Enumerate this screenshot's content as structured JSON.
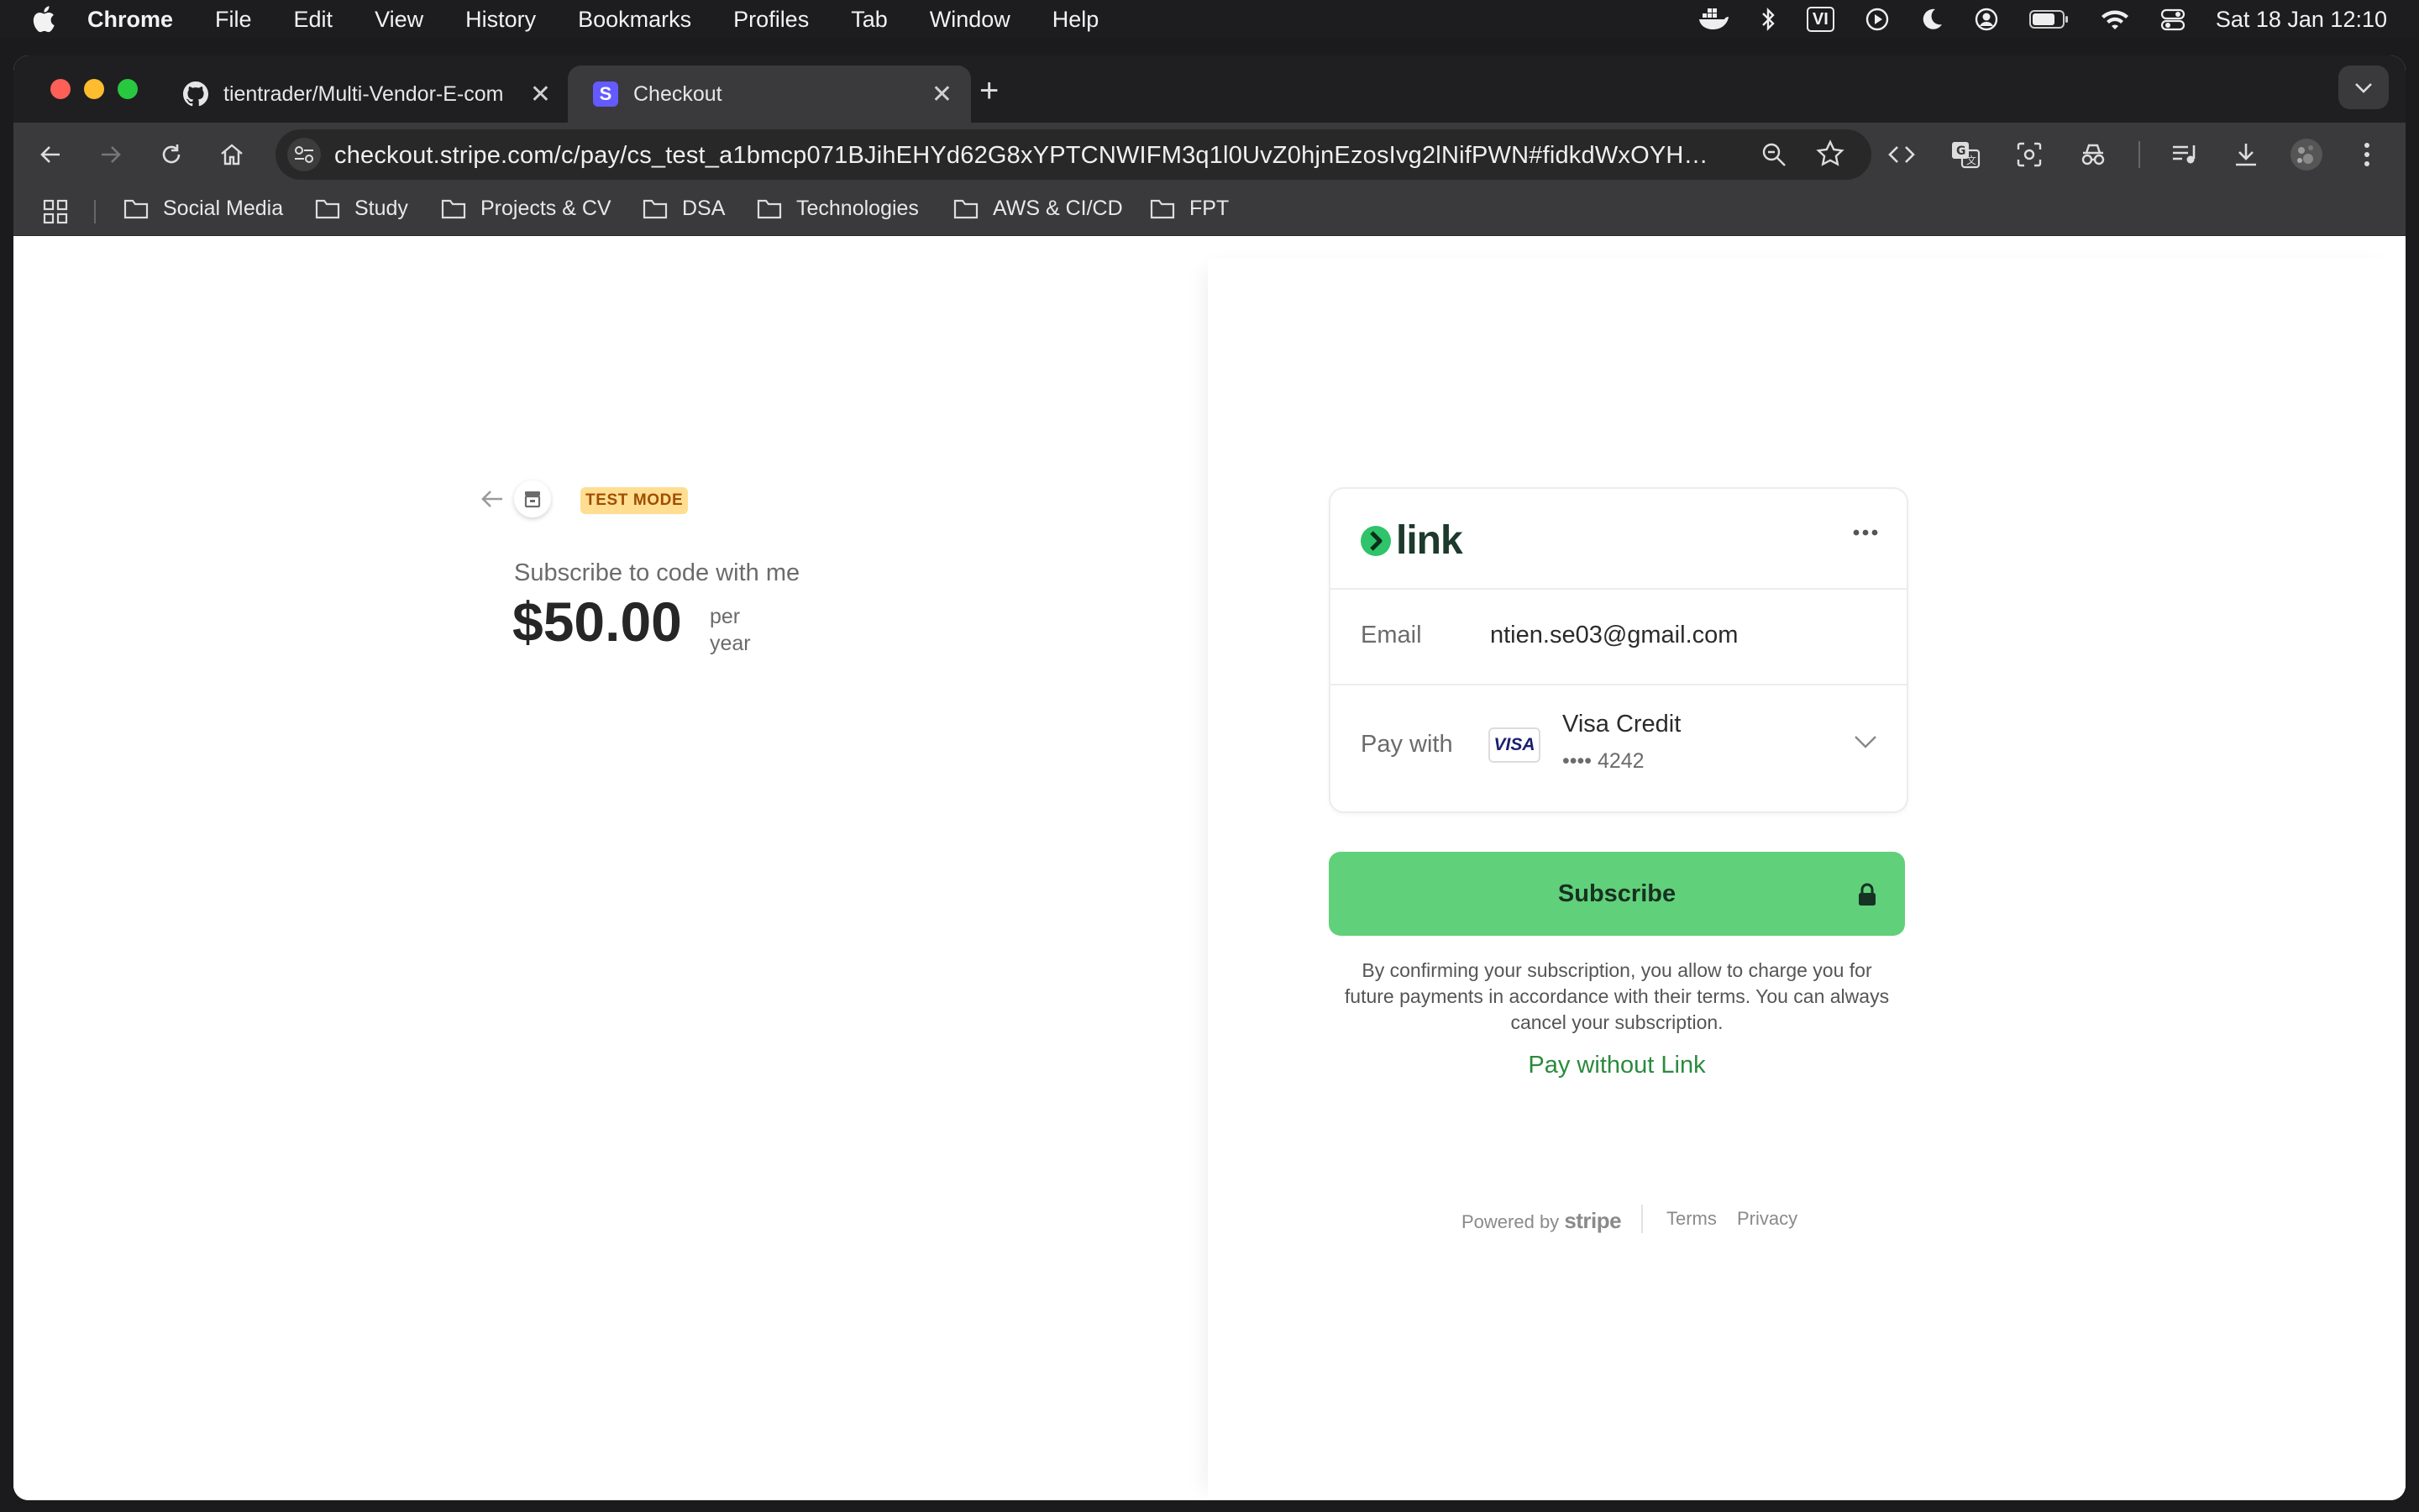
{
  "menubar": {
    "app_name": "Chrome",
    "items": [
      "File",
      "Edit",
      "View",
      "History",
      "Bookmarks",
      "Profiles",
      "Tab",
      "Window",
      "Help"
    ],
    "status_icons": [
      "docker-icon",
      "bluetooth-icon",
      "input-source-vi",
      "play-circle-icon",
      "moon-icon",
      "user-circle-icon",
      "battery-icon",
      "wifi-icon",
      "control-center-icon"
    ],
    "input_source": "VI",
    "clock": "Sat 18 Jan  12:10"
  },
  "tabs": [
    {
      "title": "tientrader/Multi-Vendor-E-com",
      "favicon": "github-icon",
      "active": false
    },
    {
      "title": "Checkout",
      "favicon": "stripe-s-icon",
      "active": true
    }
  ],
  "address_bar": {
    "url": "checkout.stripe.com/c/pay/cs_test_a1bmcp071BJihEHYd62G8xYPTCNWIFM3q1l0UvZ0hjnEzosIvg2lNifPWN#fidkdWxOYHw..."
  },
  "bookmarks": [
    "Social Media",
    "Study",
    "Projects & CV",
    "DSA",
    "Technologies",
    "AWS & CI/CD",
    "FPT"
  ],
  "checkout": {
    "test_mode_badge": "TEST MODE",
    "product_name": "Subscribe to code with me",
    "price": "$50.00",
    "period_line1": "per",
    "period_line2": "year"
  },
  "link_card": {
    "brand": "link",
    "email_label": "Email",
    "email_value": "ntien.se03@gmail.com",
    "pay_label": "Pay with",
    "card_brand_logo": "VISA",
    "card_name": "Visa Credit",
    "card_last4": "•••• 4242"
  },
  "subscribe_button": "Subscribe",
  "consent_text": "By confirming your subscription, you allow to charge you for future payments in accordance with their terms. You can always cancel your subscription.",
  "pay_without_link": "Pay without Link",
  "footer": {
    "powered_by": "Powered by",
    "stripe": "stripe",
    "terms": "Terms",
    "privacy": "Privacy"
  },
  "colors": {
    "subscribe_green": "#61d07a",
    "link_green": "#2b8a3e",
    "test_badge_bg": "#ffde92",
    "test_badge_text": "#a04e00"
  }
}
